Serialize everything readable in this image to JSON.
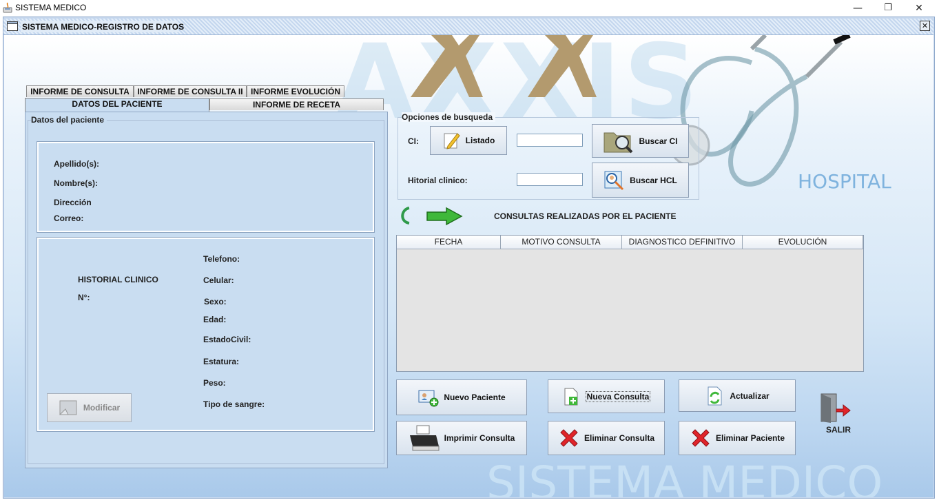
{
  "os_window": {
    "title": "SISTEMA MEDICO",
    "controls": [
      "—",
      "❐",
      "✕"
    ]
  },
  "frame": {
    "title": "SISTEMA MEDICO-REGISTRO DE DATOS",
    "close": "✕"
  },
  "background": {
    "watermark_top": "AXXIS",
    "hospital_text": "HOSPITAL",
    "watermark_bottom": "SISTEMA MEDICO"
  },
  "tabs": {
    "row1": [
      "INFORME DE CONSULTA",
      "INFORME DE CONSULTA II",
      "INFORME EVOLUCIÓN"
    ],
    "row2": [
      "DATOS DEL PACIENTE",
      "INFORME DE RECETA"
    ]
  },
  "patient": {
    "group_title": "Datos del paciente",
    "apellido": "Apellido(s):",
    "nombre": "Nombre(s):",
    "direccion": "Dirección",
    "correo": "Correo:",
    "historial": "HISTORIAL CLINICO",
    "numero": "N°:",
    "telefono": "Telefono:",
    "celular": "Celular:",
    "sexo": "Sexo:",
    "edad": "Edad:",
    "estado_civil": "EstadoCivil:",
    "estatura": "Estatura:",
    "peso": "Peso:",
    "tipo_sangre": "Tipo de sangre:",
    "modificar": "Modificar"
  },
  "search": {
    "title": "Opciones de busqueda",
    "ci_label": "CI:",
    "listado": "Listado",
    "buscar_ci": "Buscar CI",
    "hcl_label": "Hitorial clinico:",
    "buscar_hcl": "Buscar HCL",
    "ci_value": "",
    "hcl_value": ""
  },
  "consultas": {
    "title": "CONSULTAS REALIZADAS POR EL PACIENTE",
    "columns": [
      "FECHA",
      "MOTIVO CONSULTA",
      "DIAGNOSTICO DEFINITIVO",
      "EVOLUCIÓN"
    ],
    "rows": []
  },
  "actions": {
    "nuevo_paciente": "Nuevo Paciente",
    "nueva_consulta": "Nueva Consulta",
    "actualizar": "Actualizar",
    "imprimir": "Imprimir Consulta",
    "eliminar_consulta": "Eliminar Consulta",
    "eliminar_paciente": "Eliminar Paciente",
    "salir": "SALIR"
  },
  "colors": {
    "accent": "#c9ddf1",
    "title_blue": "#1b5aa5",
    "delete_red": "#e0242a",
    "arrow_green": "#3fb83a"
  }
}
